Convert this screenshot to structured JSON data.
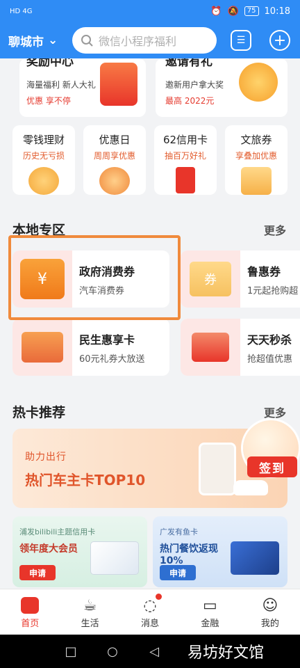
{
  "status": {
    "left": "HD 4G",
    "battery": "75",
    "time": "10:18"
  },
  "header": {
    "city": "聊城市",
    "search_placeholder": "微信小程序福利"
  },
  "top_cards": [
    {
      "title": "奖励中心",
      "line1": "海量福利 新人大礼",
      "line2": "优惠 享不停"
    },
    {
      "title": "邀请有礼",
      "line1": "邀新用户拿大奖",
      "line2": "最高 2022元"
    }
  ],
  "mini_cards": [
    {
      "title": "零钱理财",
      "sub": "历史无亏损"
    },
    {
      "title": "优惠日",
      "sub": "周周享优惠"
    },
    {
      "title": "62信用卡",
      "sub": "抽百万好礼"
    },
    {
      "title": "文旅券",
      "sub": "享叠加优惠"
    }
  ],
  "local": {
    "title": "本地专区",
    "more": "更多",
    "items": [
      {
        "title": "政府消费券",
        "sub": "汽车消费券"
      },
      {
        "title": "鲁惠券",
        "sub": "1元起抢购超"
      },
      {
        "title": "民生惠享卡",
        "sub": "60元礼券大放送"
      },
      {
        "title": "天天秒杀",
        "sub": "抢超值优惠"
      }
    ]
  },
  "hot": {
    "title": "热卡推荐",
    "more": "更多",
    "banner_small": "助力出行",
    "banner_big": "热门车主卡TOP10",
    "signin": "签到",
    "promos": [
      {
        "tag": "浦发bilibili主题信用卡",
        "title": "领年度大会员",
        "btn": "申请"
      },
      {
        "tag": "广发有鱼卡",
        "title": "热门餐饮返现 10%",
        "btn": "申请"
      }
    ]
  },
  "tabs": [
    {
      "label": "首页",
      "icon": "home-icon"
    },
    {
      "label": "生活",
      "icon": "cup-icon"
    },
    {
      "label": "消息",
      "icon": "message-icon"
    },
    {
      "label": "金融",
      "icon": "card-icon"
    },
    {
      "label": "我的",
      "icon": "user-icon"
    }
  ],
  "watermark": "易坊好文馆"
}
